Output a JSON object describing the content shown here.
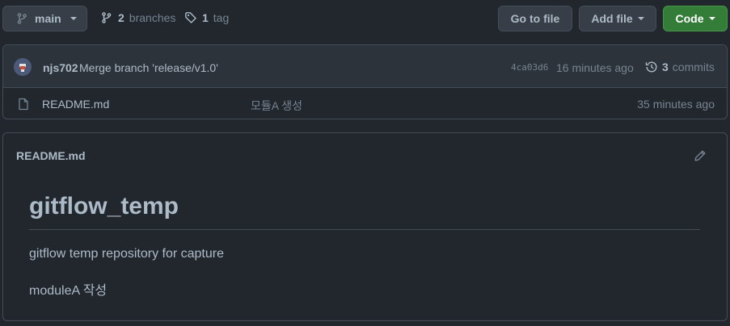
{
  "toolbar": {
    "branch": "main",
    "branches_count": "2",
    "branches_label": "branches",
    "tags_count": "1",
    "tags_label": "tag",
    "goto_file": "Go to file",
    "add_file": "Add file",
    "code": "Code"
  },
  "latest_commit": {
    "author": "njs702",
    "message": "Merge branch 'release/v1.0'",
    "hash": "4ca03d6",
    "time": "16 minutes ago",
    "commits_count": "3",
    "commits_label": "commits"
  },
  "files": [
    {
      "name": "README.md",
      "message": "모듈A 생성",
      "time": "35 minutes ago",
      "icon": "file-icon"
    }
  ],
  "readme": {
    "filename": "README.md",
    "heading": "gitflow_temp",
    "paragraphs": [
      "gitflow temp repository for capture",
      "moduleA 작성"
    ]
  },
  "colors": {
    "background": "#22272e",
    "border": "#444c56",
    "primary_button": "#347d39",
    "muted_text": "#768390",
    "text": "#adbac7"
  }
}
